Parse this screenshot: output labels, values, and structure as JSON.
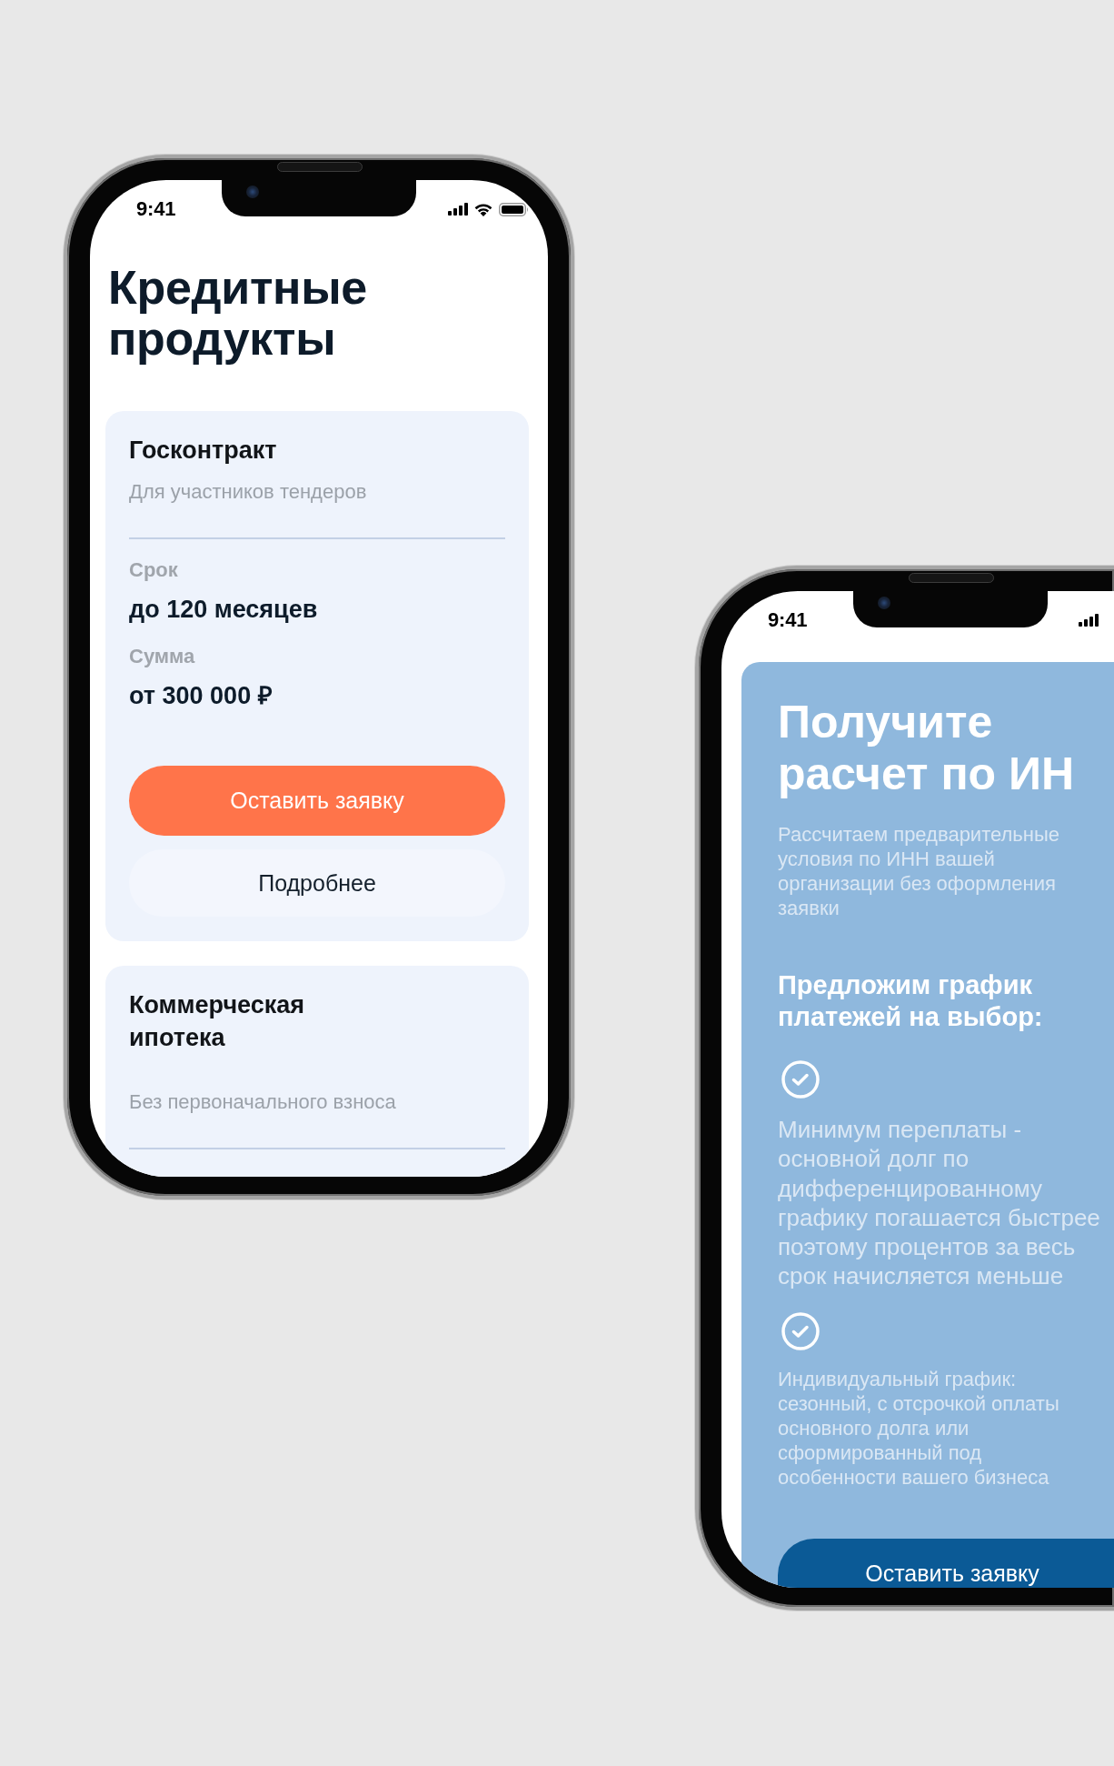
{
  "left_phone": {
    "status_bar": {
      "time": "9:41"
    },
    "title": "Кредитные продукты",
    "cards": [
      {
        "title": "Госконтракт",
        "subtitle": "Для участников тендеров",
        "terms": [
          {
            "label": "Срок",
            "value": "до 120 месяцев"
          },
          {
            "label": "Сумма",
            "value": "от 300 000 ₽"
          }
        ],
        "buttons": [
          {
            "label": "Оставить заявку",
            "kind": "primary"
          },
          {
            "label": "Подробнее",
            "kind": "secondary"
          }
        ]
      },
      {
        "title": "Коммерческая ипотека",
        "subtitle": "Без первоначального взноса"
      }
    ]
  },
  "right_phone": {
    "status_bar": {
      "time": "9:41"
    },
    "promo": {
      "title": "Получите\nрасчет по ИН",
      "description": "Рассчитаем предварительные\nусловия по ИНН вашей\nорганизации без оформления\nзаявки",
      "subheading": "Предложим график\nплатежей на выбор:",
      "benefits": [
        {
          "kind": "primary",
          "text": "Минимум переплаты -\nосновной долг по\nдифференцированному\nграфику погашается быстрее\nпоэтому процентов за весь\nсрок начисляется меньше"
        },
        {
          "kind": "secondary",
          "text": "Индивидуальный график:\nсезонный, с отсрочкой оплаты\nосновного долга или\nсформированный под\nособенности вашего бизнеса"
        }
      ],
      "button": {
        "label": "Оставить заявку"
      }
    }
  }
}
